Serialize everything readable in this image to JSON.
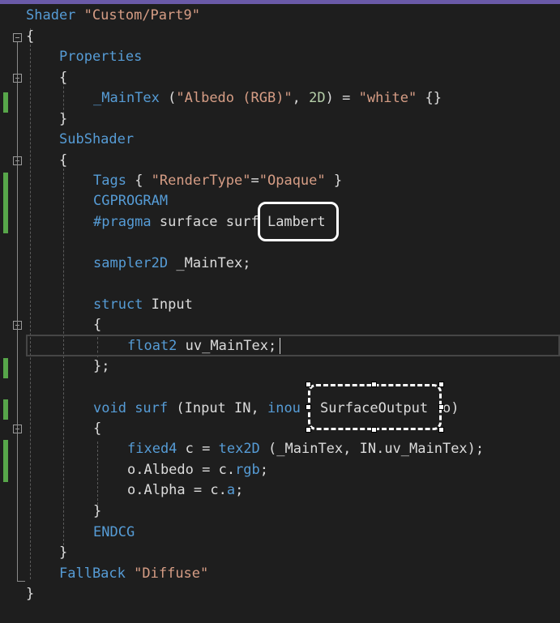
{
  "code": {
    "line1": {
      "kw": "Shader",
      "str": "\"Custom/Part9\""
    },
    "line2": "{",
    "line3": "Properties",
    "line4": "{",
    "line5": {
      "name": "_MainTex",
      "open": " (",
      "label": "\"Albedo (RGB)\"",
      "comma": ", ",
      "type": "2D",
      "eq": ") = ",
      "value": "\"white\"",
      "end": " {}"
    },
    "line6": "}",
    "line7": "SubShader",
    "line8": "{",
    "line9": {
      "tags": "Tags",
      "open": " { ",
      "key": "\"RenderType\"",
      "eq": "=",
      "val": "\"Opaque\"",
      "close": " }"
    },
    "line10": "CGPROGRAM",
    "line11": {
      "pragma": "#pragma",
      "rest": " surface surf ",
      "lighting": "Lambert"
    },
    "line12": {
      "type": "sampler2D",
      "rest": " _MainTex;"
    },
    "line13": {
      "kw": "struct",
      "rest": " Input"
    },
    "line14": "{",
    "line15": {
      "type": "float2",
      "rest": " uv_MainTex;"
    },
    "line16": "};",
    "line17": {
      "kw": "void",
      "fn": " surf",
      "args": " (Input IN, ",
      "inout": "inou",
      "out_type": "SurfaceOutput",
      "tail": "o)"
    },
    "line18": "{",
    "line19": {
      "type": "fixed4",
      "mid": " c = ",
      "fn": "tex2D",
      "args": " (_MainTex, IN.uv_MainTex);"
    },
    "line20": {
      "pre": "o.Albedo = c.",
      "swz": "rgb",
      "end": ";"
    },
    "line21": {
      "pre": "o.Alpha = c.",
      "swz": "a",
      "end": ";"
    },
    "line22": "}",
    "line23": "ENDCG",
    "line24": "}",
    "line25": {
      "kw": "FallBack",
      "str": "\"Diffuse\""
    },
    "line26": "}"
  },
  "colors": {
    "keyword": "#569cd6",
    "string": "#d69d85",
    "number": "#b5cea8",
    "text": "#dcdcdc",
    "change_bar": "#57a64a"
  }
}
